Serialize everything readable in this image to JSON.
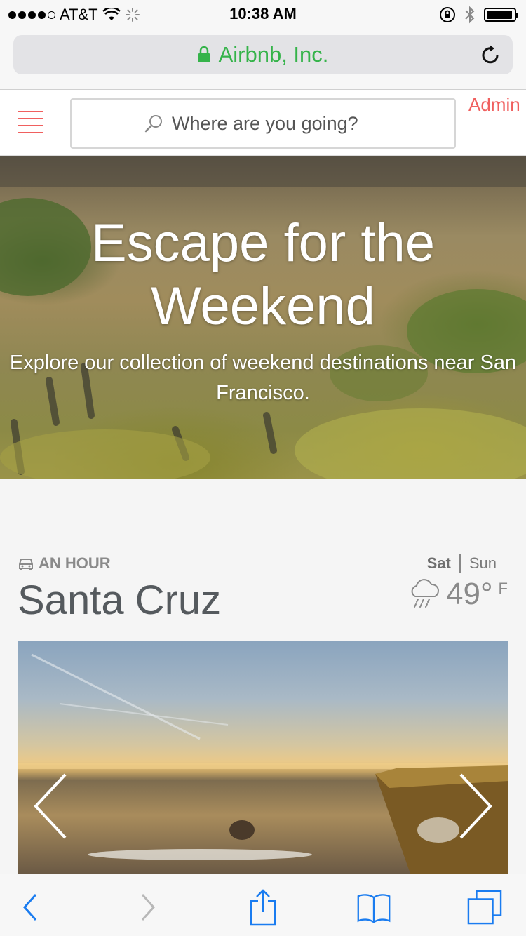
{
  "status_bar": {
    "carrier": "AT&T",
    "time": "10:38 AM",
    "signal_bars_filled": 4,
    "battery_level": 0.95
  },
  "browser": {
    "page_title": "Airbnb, Inc.",
    "accent_color": "#35b34a"
  },
  "header": {
    "search_placeholder": "Where are you going?",
    "admin_label": "Admin",
    "brand_color": "#f0605f"
  },
  "hero": {
    "title": "Escape for the Weekend",
    "subtitle": "Explore our collection of weekend destinations near San Francisco."
  },
  "destination": {
    "travel_time": "AN HOUR",
    "name": "Santa Cruz",
    "days": [
      "Sat",
      "Sun"
    ],
    "selected_day": "Sat",
    "temperature": "49°",
    "unit": "F",
    "weather_icon": "rain-cloud-icon"
  },
  "icons": {
    "lock": "lock-icon",
    "reload": "reload-icon",
    "menu": "hamburger-icon",
    "search": "search-icon",
    "car": "car-icon",
    "prev": "chevron-left-icon",
    "next": "chevron-right-icon",
    "share": "share-icon",
    "bookmarks": "bookmarks-icon",
    "tabs": "tabs-icon"
  },
  "toolbar": {
    "tint": "#1a7cf0",
    "disabled_tint": "#b8b8b8"
  }
}
